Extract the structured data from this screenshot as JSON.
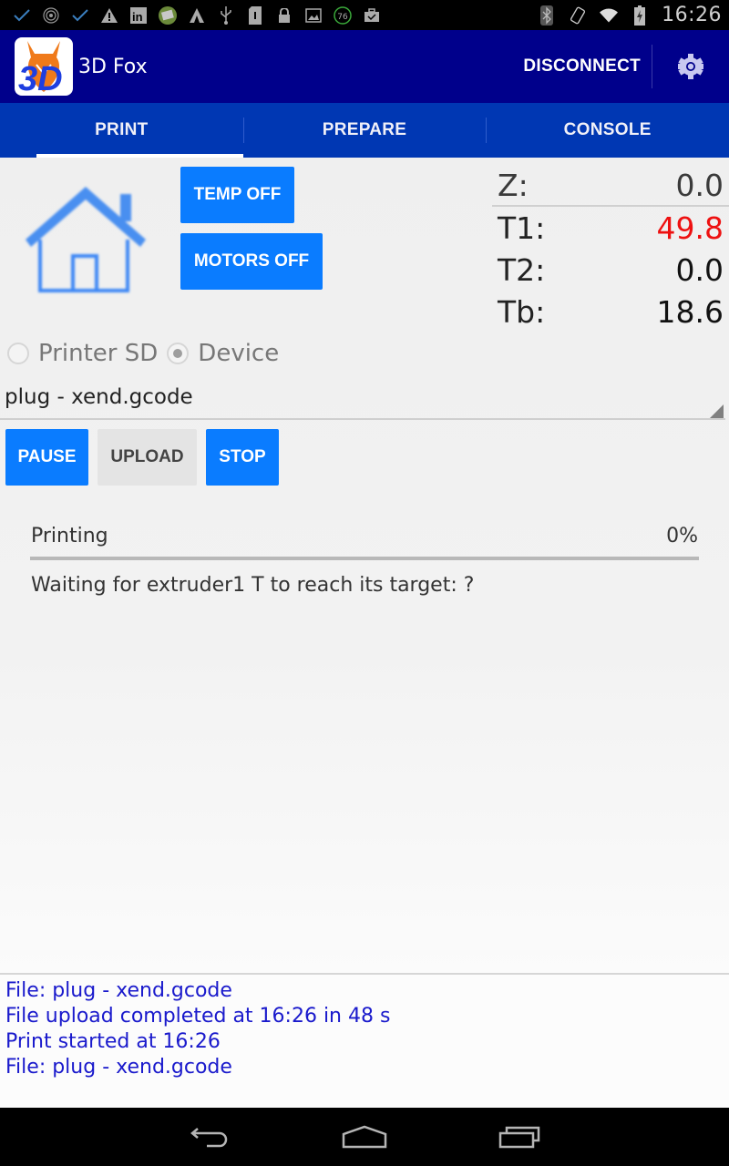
{
  "status_bar": {
    "left_icons": [
      "check-icon",
      "radar-icon",
      "check-icon",
      "warning-icon",
      "linkedin-icon",
      "app-thumbnail-icon",
      "triangle-a-icon",
      "usb-icon",
      "sd-card-icon",
      "lock-icon",
      "image-icon",
      "battery-76-badge-icon",
      "briefcase-check-icon"
    ],
    "badge_value": "76",
    "right_icons": [
      "bluetooth-icon",
      "screen-rotation-icon",
      "wifi-icon",
      "battery-charging-icon"
    ],
    "time": "16:26"
  },
  "action_bar": {
    "app_title": "3D Fox",
    "logo_text": "3D",
    "disconnect_label": "DISCONNECT",
    "settings_icon": "gear-icon"
  },
  "tabs": [
    {
      "label": "PRINT",
      "active": true
    },
    {
      "label": "PREPARE",
      "active": false
    },
    {
      "label": "CONSOLE",
      "active": false
    }
  ],
  "controls": {
    "home_icon": "home-icon",
    "temp_off_label": "TEMP OFF",
    "motors_off_label": "MOTORS OFF"
  },
  "readouts": [
    {
      "label": "Z:",
      "value": "0.0"
    },
    {
      "label": "T1:",
      "value": "49.8",
      "color": "#ee1111"
    },
    {
      "label": "T2:",
      "value": "0.0"
    },
    {
      "label": "Tb:",
      "value": "18.6"
    }
  ],
  "source": {
    "options": [
      {
        "label": "Printer SD",
        "checked": false
      },
      {
        "label": "Device",
        "checked": true
      }
    ]
  },
  "file_select": {
    "selected": "plug - xend.gcode"
  },
  "print_buttons": {
    "pause_label": "PAUSE",
    "upload_label": "UPLOAD",
    "stop_label": "STOP"
  },
  "progress": {
    "label": "Printing",
    "percent_text": "0%",
    "percent": 0,
    "status_message": "Waiting for extruder1 T to reach its target: ?"
  },
  "log": [
    "File: plug - xend.gcode",
    "File upload completed at 16:26 in 48 s",
    "Print started at 16:26",
    "File: plug - xend.gcode"
  ],
  "nav_bar": {
    "icons": [
      "back-icon",
      "home-nav-icon",
      "recents-icon"
    ]
  },
  "colors": {
    "action_bar": "#00008b",
    "tab_bar": "#0037b3",
    "button_blue": "#0a7cff",
    "log_text": "#1a1acc",
    "alert_red": "#ee1111"
  }
}
